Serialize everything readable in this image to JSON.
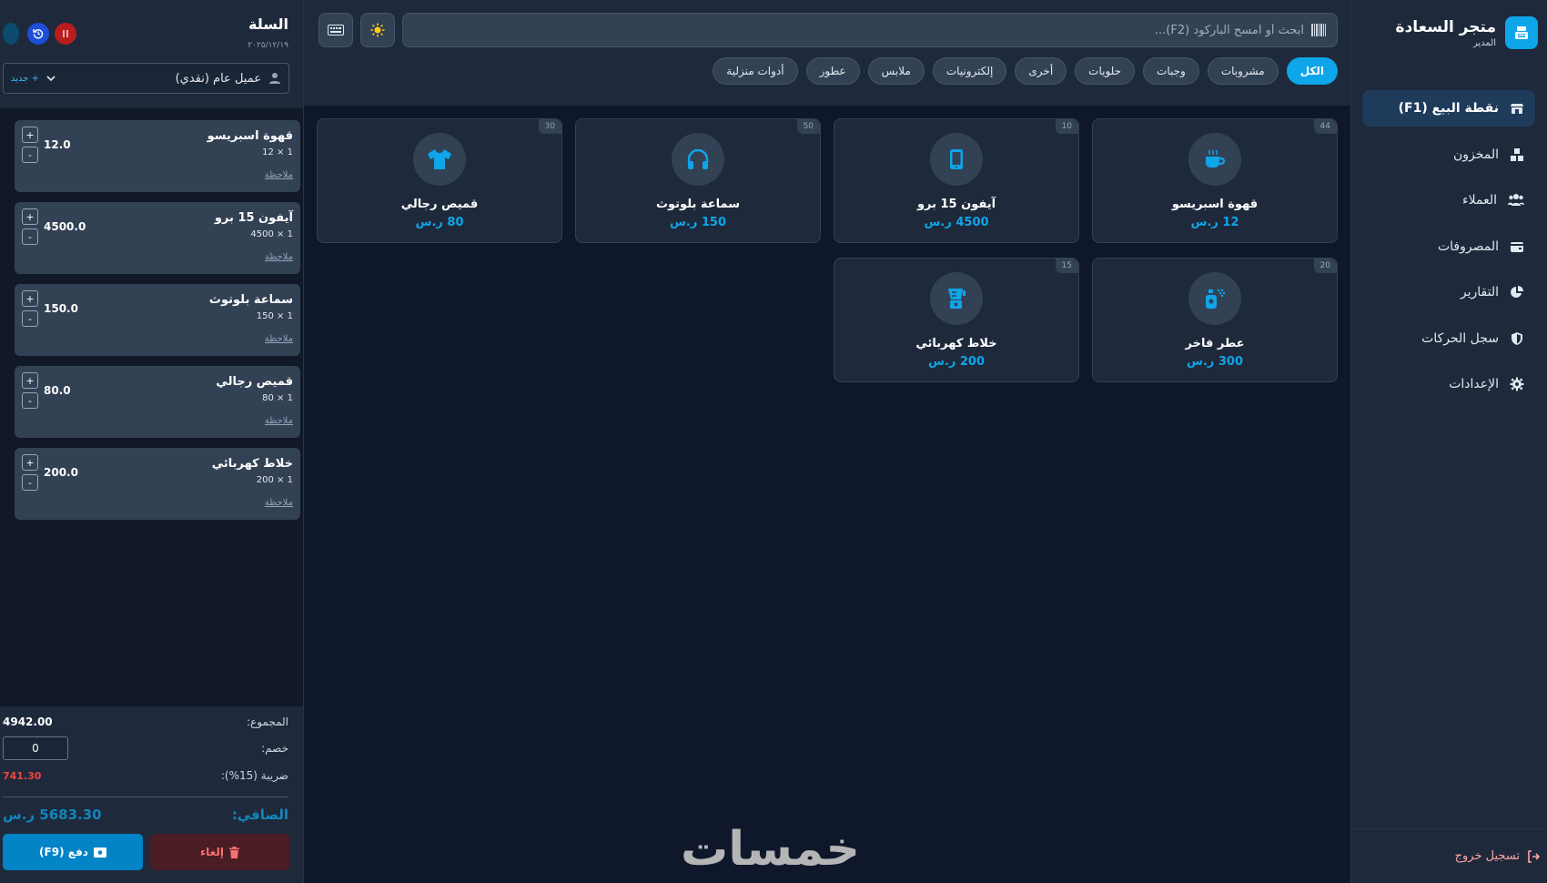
{
  "brand": {
    "name": "متجر السعادة",
    "role": "المدير"
  },
  "nav": {
    "items": [
      {
        "label": "نقطة البيع (F1)",
        "icon": "store-icon",
        "active": true
      },
      {
        "label": "المخزون",
        "icon": "boxes-icon",
        "active": false
      },
      {
        "label": "العملاء",
        "icon": "users-icon",
        "active": false
      },
      {
        "label": "المصروفات",
        "icon": "wallet-icon",
        "active": false
      },
      {
        "label": "التقارير",
        "icon": "pie-chart-icon",
        "active": false
      },
      {
        "label": "سجل الحركات",
        "icon": "shield-icon",
        "active": false
      },
      {
        "label": "الإعدادات",
        "icon": "gear-icon",
        "active": false
      }
    ],
    "logout": "تسجيل خروج"
  },
  "search": {
    "placeholder": "ابحث أو امسح الباركود (F2)..."
  },
  "categories": [
    "الكل",
    "مشروبات",
    "وجبات",
    "حلويات",
    "أخرى",
    "إلكترونيات",
    "ملابس",
    "عطور",
    "أدوات منزلية"
  ],
  "active_category": "الكل",
  "products": [
    {
      "name": "قهوة اسبريسو",
      "price": "12 ر.س",
      "stock": "44",
      "icon": "coffee-icon"
    },
    {
      "name": "آيفون 15 برو",
      "price": "4500 ر.س",
      "stock": "10",
      "icon": "phone-icon"
    },
    {
      "name": "سماعة بلوتوث",
      "price": "150 ر.س",
      "stock": "50",
      "icon": "headphones-icon"
    },
    {
      "name": "قميص رجالي",
      "price": "80 ر.س",
      "stock": "30",
      "icon": "shirt-icon"
    },
    {
      "name": "عطر فاخر",
      "price": "300 ر.س",
      "stock": "20",
      "icon": "perfume-icon"
    },
    {
      "name": "خلاط كهربائي",
      "price": "200 ر.س",
      "stock": "15",
      "icon": "blender-icon"
    }
  ],
  "cart": {
    "title": "السلة",
    "date": "٢٠٢٥/١٢/١٩",
    "customer": "عميل عام (نقدي)",
    "new_customer": "+ جديد",
    "items": [
      {
        "name": "قهوة اسبريسو",
        "qty": "1 × 12",
        "total": "12.0",
        "note": "ملاحظة"
      },
      {
        "name": "آيفون 15 برو",
        "qty": "1 × 4500",
        "total": "4500.0",
        "note": "ملاحظة"
      },
      {
        "name": "سماعة بلوتوث",
        "qty": "1 × 150",
        "total": "150.0",
        "note": "ملاحظة"
      },
      {
        "name": "قميص رجالي",
        "qty": "1 × 80",
        "total": "80.0",
        "note": "ملاحظة"
      },
      {
        "name": "خلاط كهربائي",
        "qty": "1 × 200",
        "total": "200.0",
        "note": "ملاحظة"
      }
    ],
    "subtotal_label": "المجموع:",
    "subtotal": "4942.00",
    "discount_label": "خصم:",
    "discount": "0",
    "tax_label": "ضريبة (15%):",
    "tax": "741.30",
    "net_label": "الصافي:",
    "net": "5683.30 ر.س",
    "pay_label": "دفع (F9)",
    "cancel_label": "إلغاء"
  },
  "watermark": "خمسات",
  "colors": {
    "accent": "#0ea5e9",
    "bg": "#0f172a",
    "panel": "#1e293b",
    "danger": "#ef4444"
  }
}
